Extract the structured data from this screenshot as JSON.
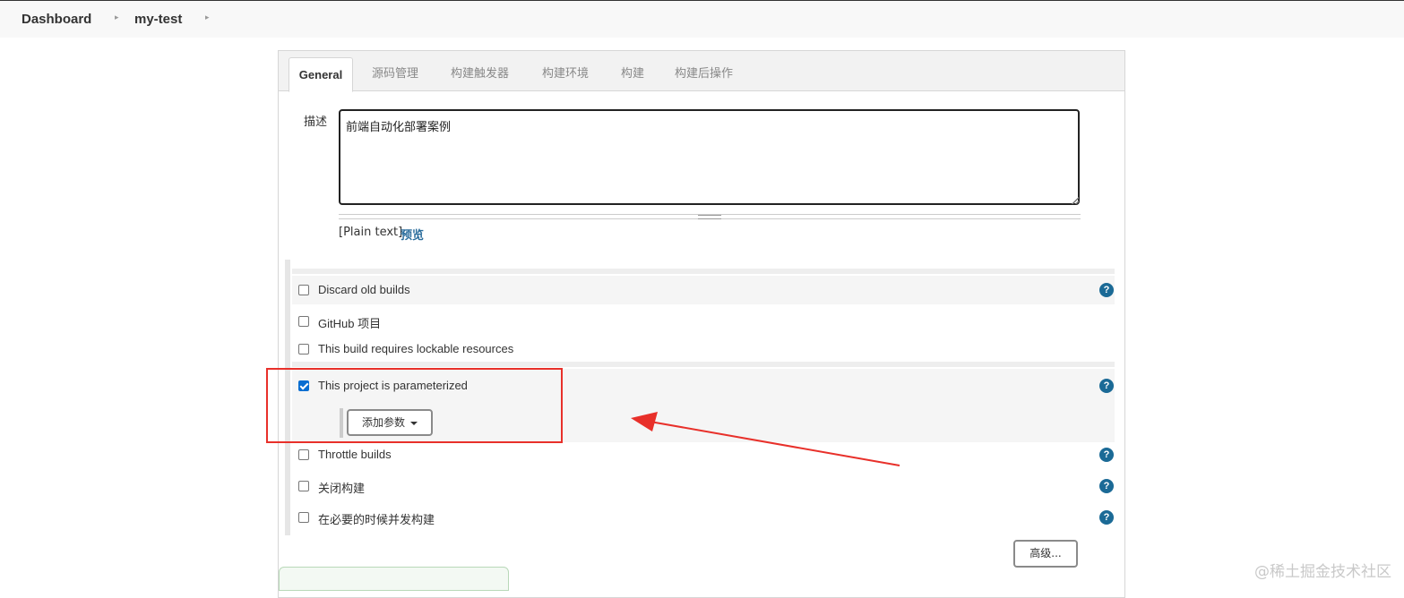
{
  "breadcrumb": {
    "items": [
      "Dashboard",
      "my-test"
    ]
  },
  "tabs": [
    "General",
    "源码管理",
    "构建触发器",
    "构建环境",
    "构建",
    "构建后操作"
  ],
  "description": {
    "label": "描述",
    "value": "前端自动化部署案例",
    "format_text": "[Plain text]",
    "preview_link": "预览"
  },
  "options": [
    {
      "label": "Discard old builds",
      "checked": false
    },
    {
      "label": "GitHub 项目",
      "checked": false
    },
    {
      "label": "This build requires lockable resources",
      "checked": false
    },
    {
      "label": "This project is parameterized",
      "checked": true
    },
    {
      "label": "Throttle builds",
      "checked": false
    },
    {
      "label": "关闭构建",
      "checked": false
    },
    {
      "label": "在必要的时候并发构建",
      "checked": false
    }
  ],
  "add_param_button": "添加参数",
  "advanced_button": "高级...",
  "help_glyph": "?",
  "watermark": "@稀土掘金技术社区",
  "colors": {
    "accent_blue": "#0a6ed1",
    "link_blue": "#2b6d9c",
    "annotation_red": "#e8302a"
  }
}
